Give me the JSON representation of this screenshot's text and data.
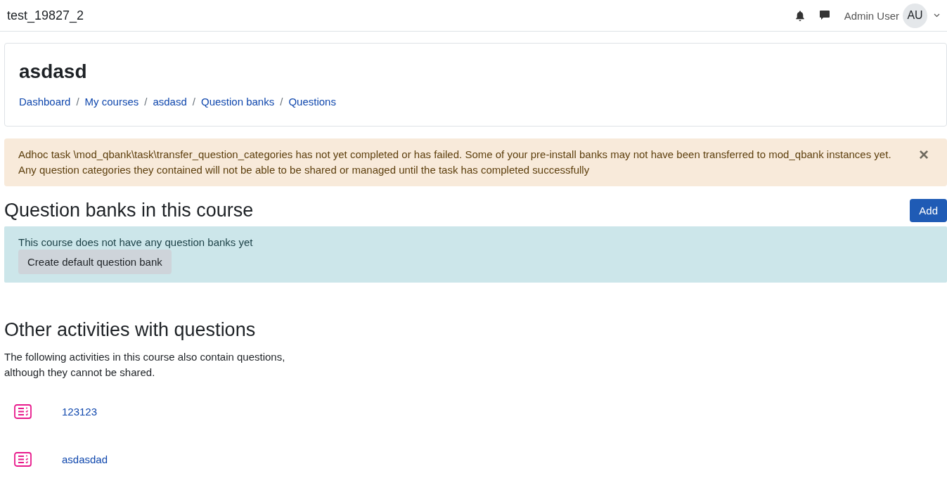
{
  "navbar": {
    "site_name": "test_19827_2",
    "user_name": "Admin User",
    "avatar_initials": "AU"
  },
  "header": {
    "title": "asdasd",
    "breadcrumbs": [
      "Dashboard",
      "My courses",
      "asdasd",
      "Question banks",
      "Questions"
    ],
    "separator": "/"
  },
  "warning": {
    "message": "Adhoc task \\mod_qbank\\task\\transfer_question_categories has not yet completed or has failed. Some of your pre-install banks may not have been transferred to mod_qbank instances yet. Any question categories they contained will not be able to be shared or managed until the task has completed successfully",
    "close": "×"
  },
  "banks": {
    "heading": "Question banks in this course",
    "add_button": "Add",
    "notice": "This course does not have any question banks yet",
    "create_button": "Create default question bank"
  },
  "other": {
    "heading": "Other activities with questions",
    "description": "The following activities in this course also contain questions, although they cannot be shared.",
    "activities": [
      {
        "name": "123123"
      },
      {
        "name": "asdasdad"
      }
    ]
  }
}
